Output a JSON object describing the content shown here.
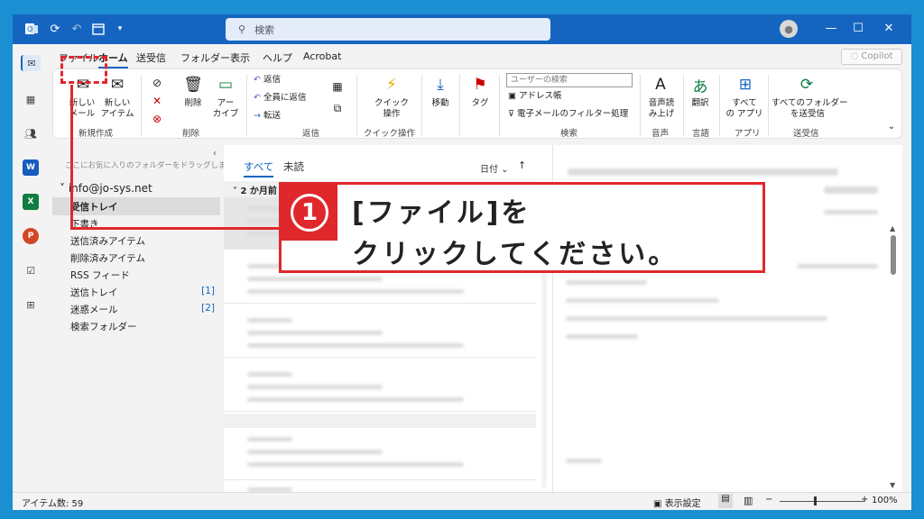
{
  "search": {
    "placeholder": "検索"
  },
  "menu": {
    "file": "ファイル",
    "home": "ホーム",
    "send_receive": "送受信",
    "folder": "フォルダー",
    "view": "表示",
    "help": "ヘルプ",
    "acrobat": "Acrobat",
    "copilot": "Copilot"
  },
  "ribbon": {
    "new_mail": "新しい\nメール",
    "new_item": "新しい\nアイテム",
    "group_new": "新規作成",
    "delete": "削除",
    "archive": "アー\nカイブ",
    "group_delete": "削除",
    "reply": "返信",
    "reply_all": "全員に返信",
    "forward": "転送",
    "group_respond": "返信",
    "quick_steps": "クイック\n操作",
    "group_quick": "クイック操作",
    "move": "移動",
    "tag": "タグ",
    "user_search_placeholder": "ユーザーの検索",
    "address_book": "アドレス帳",
    "filter_email": "電子メールのフィルター処理",
    "group_find": "検索",
    "read_aloud": "音声読\nみ上げ",
    "group_voice": "音声",
    "translate": "翻訳",
    "group_language": "言語",
    "all_apps": "すべて\nの アプリ",
    "group_apps": "アプリ",
    "send_all": "すべてのフォルダー\nを送受信",
    "group_sendrecv": "送受信"
  },
  "folders": {
    "drag_hint": "ここにお気に入りのフォルダーをドラッグします",
    "account": "info@jo-sys.net",
    "items": [
      {
        "label": "受信トレイ",
        "count": ""
      },
      {
        "label": "下書き",
        "count": ""
      },
      {
        "label": "送信済みアイテム",
        "count": ""
      },
      {
        "label": "削除済みアイテム",
        "count": ""
      },
      {
        "label": "RSS フィード",
        "count": ""
      },
      {
        "label": "送信トレイ",
        "count": "[1]"
      },
      {
        "label": "迷惑メール",
        "count": "[2]"
      },
      {
        "label": "検索フォルダー",
        "count": ""
      }
    ]
  },
  "list": {
    "tab_all": "すべて",
    "tab_unread": "未読",
    "sort": "日付",
    "group_header": "2 か月前"
  },
  "status": {
    "item_count": "アイテム数: 59",
    "display_settings": "表示設定",
    "zoom": "100%"
  },
  "callout": {
    "number": "1",
    "line1": "[ファイル]を",
    "line2": "クリックしてください。"
  },
  "colors": {
    "accent": "#1565c0",
    "highlight": "#e0282c",
    "background": "#1a8fd1"
  }
}
